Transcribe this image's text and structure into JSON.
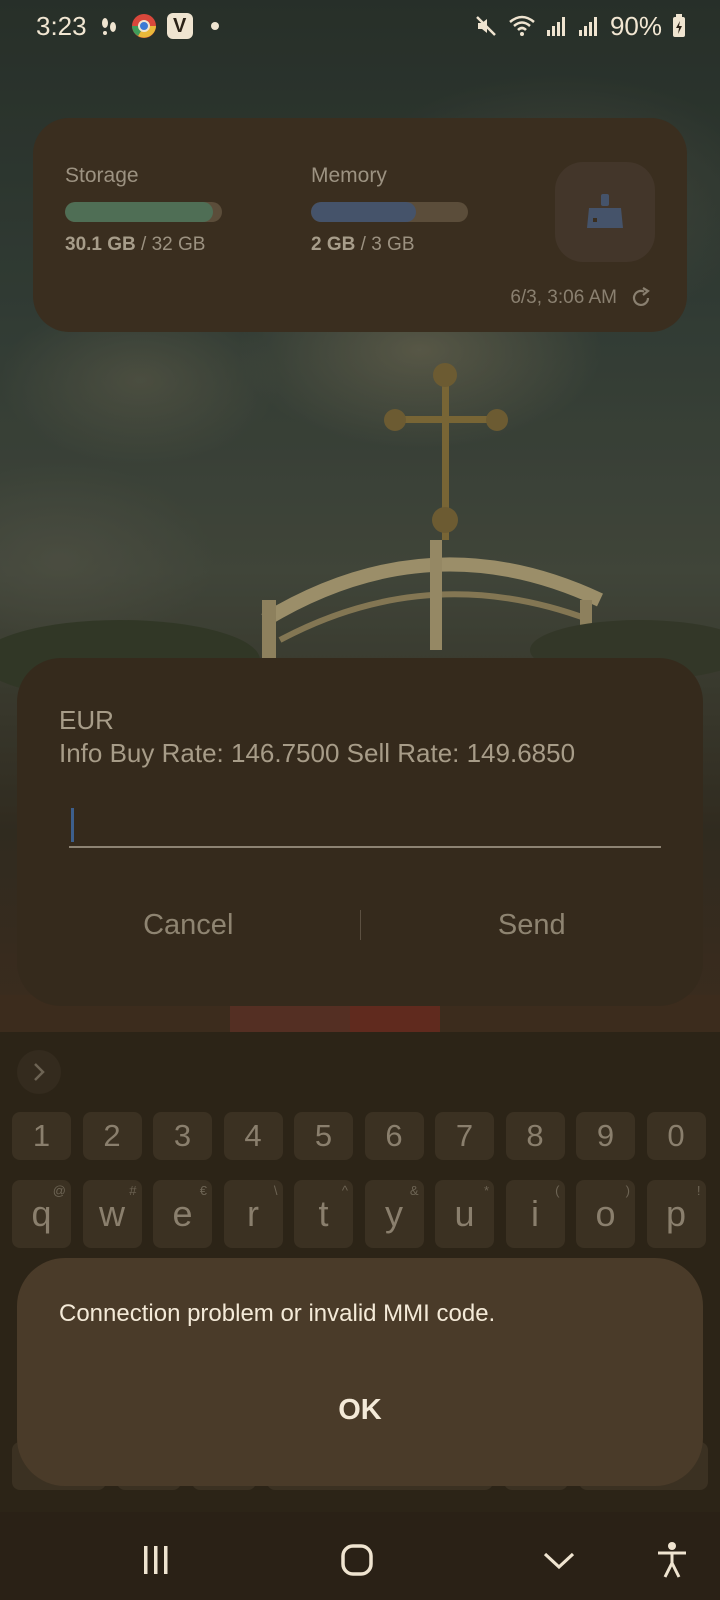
{
  "status_bar": {
    "time": "3:23",
    "battery": "90%",
    "icons": [
      "steps-icon",
      "chrome-icon",
      "app-v-icon",
      "notification-dot",
      "mute-icon",
      "wifi-icon",
      "signal-icon",
      "signal-icon-2",
      "battery-charging-icon"
    ]
  },
  "widget": {
    "storage": {
      "title": "Storage",
      "used": "30.1 GB",
      "total": " / 32 GB",
      "fraction": 0.94,
      "color": "#4f6e55"
    },
    "memory": {
      "title": "Memory",
      "used": "2 GB",
      "total": " / 3 GB",
      "fraction": 0.67,
      "color": "#45536a"
    },
    "timestamp": "6/3, 3:06 AM"
  },
  "ussd_dialog": {
    "line1": "EUR",
    "line2": "Info Buy Rate: 146.7500 Sell Rate: 149.6850",
    "input_value": "",
    "cancel_label": "Cancel",
    "send_label": "Send"
  },
  "keyboard": {
    "number_row": [
      "1",
      "2",
      "3",
      "4",
      "5",
      "6",
      "7",
      "8",
      "9",
      "0"
    ],
    "letter_row": [
      {
        "key": "q",
        "sub": "@"
      },
      {
        "key": "w",
        "sub": "#"
      },
      {
        "key": "e",
        "sub": "€"
      },
      {
        "key": "r",
        "sub": "\\"
      },
      {
        "key": "t",
        "sub": "^"
      },
      {
        "key": "y",
        "sub": "&"
      },
      {
        "key": "u",
        "sub": "*"
      },
      {
        "key": "i",
        "sub": "("
      },
      {
        "key": "o",
        "sub": ")"
      },
      {
        "key": "p",
        "sub": "!"
      }
    ]
  },
  "alert_dialog": {
    "message": "Connection problem or invalid MMI code.",
    "ok_label": "OK"
  },
  "nav_bar": {
    "buttons": [
      "recents-icon",
      "home-icon",
      "hide-keyboard-icon",
      "accessibility-icon"
    ]
  }
}
